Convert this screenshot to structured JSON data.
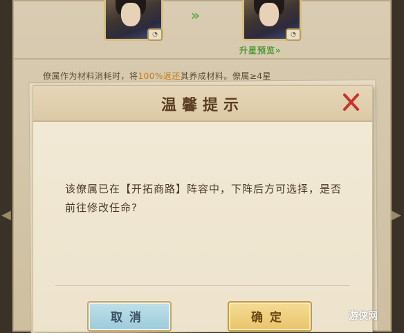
{
  "background": {
    "arrow_glyph": "»",
    "star_preview_label": "升星预览»",
    "info_pre": "僚属作为材料消耗时，将",
    "info_highlight": "100%返还",
    "info_post": "其养成材料。僚属≥4星"
  },
  "dialog": {
    "title": "温馨提示",
    "message": "该僚属已在【开拓商路】阵容中，下阵后方可选择，是否前往修改任命?",
    "cancel_label": "取消",
    "confirm_label": "确定"
  },
  "watermark": "游侠网",
  "colors": {
    "accent_green": "#5ea84a",
    "highlight_orange": "#c47b18",
    "close_red": "#c7332b"
  },
  "icons": {
    "close": "close-icon",
    "arrow": "double-chevron-right-icon"
  }
}
